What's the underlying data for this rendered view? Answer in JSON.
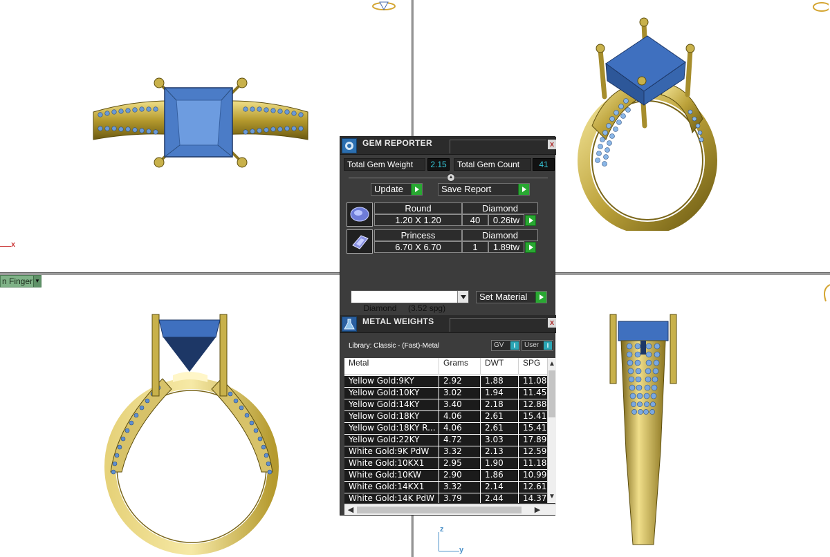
{
  "viewport": {
    "view_selector_label": "n Finger",
    "axis_x": "x",
    "axis_z": "z",
    "axis_y": "y"
  },
  "gem_reporter": {
    "title": "GEM REPORTER",
    "close": "x",
    "total_gem_weight_label": "Total Gem Weight",
    "total_gem_weight_value": "2.15",
    "total_gem_count_label": "Total Gem Count",
    "total_gem_count_value": "41",
    "update_label": "Update",
    "save_report_label": "Save Report",
    "gems": [
      {
        "cut": "Round",
        "material": "Diamond",
        "size": "1.20 X 1.20",
        "count": "40",
        "weight": "0.26tw"
      },
      {
        "cut": "Princess",
        "material": "Diamond",
        "size": "6.70 X 6.70",
        "count": "1",
        "weight": "1.89tw"
      }
    ],
    "material_select_value": "Diamond     (3.52 spg)",
    "set_material_label": "Set Material"
  },
  "metal_weights": {
    "title": "METAL WEIGHTS",
    "close": "x",
    "library_label": "Library: Classic - (Fast)-Metal",
    "gv_label": "GV",
    "user_label": "User",
    "toggle_glyph": "I",
    "columns": [
      "Metal",
      "Grams",
      "DWT",
      "SPG"
    ],
    "rows": [
      [
        "Yellow Gold:9KY",
        "2.92",
        "1.88",
        "11.08"
      ],
      [
        "Yellow Gold:10KY",
        "3.02",
        "1.94",
        "11.45"
      ],
      [
        "Yellow Gold:14KY",
        "3.40",
        "2.18",
        "12.88"
      ],
      [
        "Yellow Gold:18KY",
        "4.06",
        "2.61",
        "15.41"
      ],
      [
        "Yellow Gold:18KY R...",
        "4.06",
        "2.61",
        "15.41"
      ],
      [
        "Yellow Gold:22KY",
        "4.72",
        "3.03",
        "17.89"
      ],
      [
        "White Gold:9K PdW",
        "3.32",
        "2.13",
        "12.59"
      ],
      [
        "White Gold:10KX1",
        "2.95",
        "1.90",
        "11.18"
      ],
      [
        "White Gold:10KW",
        "2.90",
        "1.86",
        "10.99"
      ],
      [
        "White Gold:14KX1",
        "3.32",
        "2.14",
        "12.61"
      ],
      [
        "White Gold:14K PdW",
        "3.79",
        "2.44",
        "14.37"
      ]
    ]
  }
}
